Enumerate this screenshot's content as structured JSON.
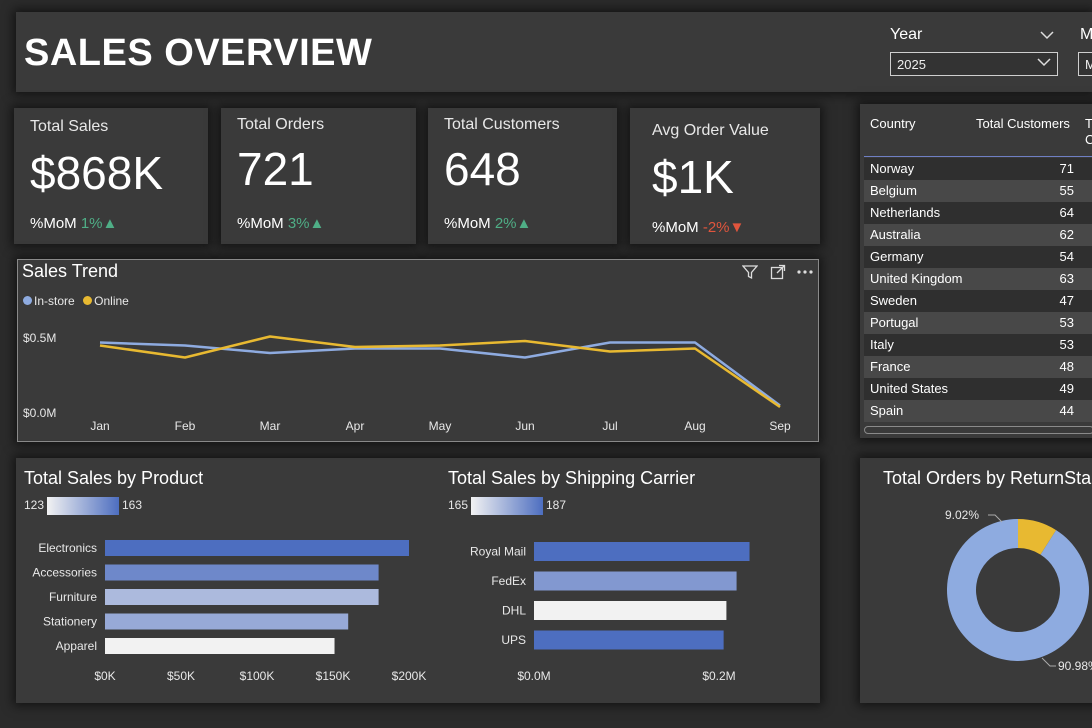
{
  "header": {
    "title": "SALES OVERVIEW",
    "year_label": "Year",
    "year_value": "2025",
    "month_label": "M",
    "month_value": "M"
  },
  "kpis": [
    {
      "title": "Total Sales",
      "value": "$868K",
      "mom_label": "%MoM",
      "mom_value": "1%",
      "trend": "up"
    },
    {
      "title": "Total Orders",
      "value": "721",
      "mom_label": "%MoM",
      "mom_value": "3%",
      "trend": "up"
    },
    {
      "title": "Total Customers",
      "value": "648",
      "mom_label": "%MoM",
      "mom_value": "2%",
      "trend": "up"
    },
    {
      "title": "Avg Order Value",
      "value": "$1K",
      "mom_label": "%MoM",
      "mom_value": "-2%",
      "trend": "down"
    }
  ],
  "icons": {
    "up": "▲",
    "down": "▼",
    "filter": "filter-icon",
    "focus": "focus-mode-icon",
    "more": "more-options-icon"
  },
  "colors": {
    "instore": "#8eabe0",
    "online": "#e8b931",
    "bar_dark": "#4d6ec0",
    "bar_light": "#ececec",
    "up": "#4fae86",
    "down": "#e0553d"
  },
  "trend": {
    "title": "Sales Trend",
    "legend": [
      "In-store",
      "Online"
    ],
    "y_ticks": [
      "$0.5M",
      "$0.0M"
    ]
  },
  "table": {
    "columns": [
      "Country",
      "Total Customers",
      "T",
      "C"
    ],
    "rows": [
      {
        "country": "Norway",
        "customers": "71"
      },
      {
        "country": "Belgium",
        "customers": "55"
      },
      {
        "country": "Netherlands",
        "customers": "64"
      },
      {
        "country": "Australia",
        "customers": "62"
      },
      {
        "country": "Germany",
        "customers": "54"
      },
      {
        "country": "United Kingdom",
        "customers": "63"
      },
      {
        "country": "Sweden",
        "customers": "47"
      },
      {
        "country": "Portugal",
        "customers": "53"
      },
      {
        "country": "Italy",
        "customers": "53"
      },
      {
        "country": "France",
        "customers": "48"
      },
      {
        "country": "United States",
        "customers": "49"
      },
      {
        "country": "Spain",
        "customers": "44"
      }
    ]
  },
  "product": {
    "title": "Total Sales by Product",
    "legend_min": "123",
    "legend_max": "163",
    "x_ticks": [
      "$0K",
      "$50K",
      "$100K",
      "$150K",
      "$200K"
    ]
  },
  "carrier": {
    "title": "Total Sales by Shipping Carrier",
    "legend_min": "165",
    "legend_max": "187",
    "x_ticks": [
      "$0.0M",
      "$0.2M"
    ]
  },
  "donut": {
    "title": "Total Orders by ReturnSta",
    "labels": [
      "9.02%",
      "90.98%"
    ]
  },
  "chart_data": [
    {
      "type": "line",
      "title": "Sales Trend",
      "x": [
        "Jan",
        "Feb",
        "Mar",
        "Apr",
        "May",
        "Jun",
        "Jul",
        "Aug",
        "Sep"
      ],
      "series": [
        {
          "name": "In-store",
          "values": [
            0.47,
            0.45,
            0.4,
            0.43,
            0.43,
            0.37,
            0.47,
            0.47,
            0.05
          ]
        },
        {
          "name": "Online",
          "values": [
            0.45,
            0.37,
            0.51,
            0.44,
            0.45,
            0.48,
            0.41,
            0.43,
            0.04
          ]
        }
      ],
      "ylim": [
        0,
        0.5
      ],
      "xlabel": "",
      "ylabel": ""
    },
    {
      "type": "bar",
      "title": "Total Sales by Product",
      "categories": [
        "Electronics",
        "Accessories",
        "Furniture",
        "Stationery",
        "Apparel"
      ],
      "values": [
        200,
        180,
        180,
        160,
        151
      ],
      "color_values": [
        163,
        155,
        140,
        145,
        123
      ],
      "xlim": [
        0,
        200
      ],
      "orientation": "horizontal"
    },
    {
      "type": "bar",
      "title": "Total Sales by Shipping Carrier",
      "categories": [
        "Royal Mail",
        "FedEx",
        "DHL",
        "UPS"
      ],
      "values": [
        0.233,
        0.219,
        0.208,
        0.205
      ],
      "color_values": [
        187,
        180,
        165,
        187
      ],
      "xlim": [
        0,
        0.2
      ],
      "orientation": "horizontal"
    },
    {
      "type": "pie",
      "title": "Total Orders by ReturnSta",
      "values": [
        9.02,
        90.98
      ],
      "colors": [
        "#e8b931",
        "#8eabe0"
      ],
      "donut": true
    }
  ]
}
